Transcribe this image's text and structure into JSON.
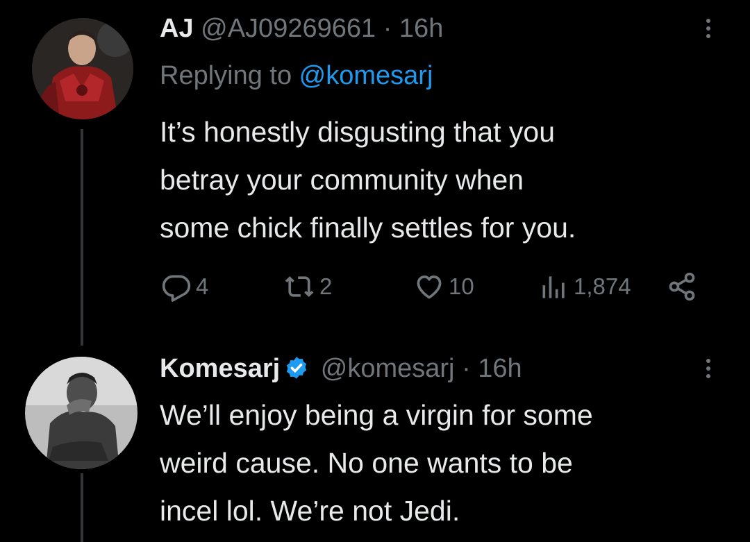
{
  "tweets": [
    {
      "name": "AJ",
      "handle": "@AJ09269661",
      "separator": "·",
      "time": "16h",
      "replying_prefix": "Replying to ",
      "replying_to": "@komesarj",
      "text": "It’s honestly disgusting that you\nbetray your community when\nsome chick finally settles for you.",
      "actions": {
        "replies": "4",
        "retweets": "2",
        "likes": "10",
        "views": "1,874"
      }
    },
    {
      "name": "Komesarj",
      "verified": true,
      "handle": "@komesarj",
      "separator": "·",
      "time": "16h",
      "text": "We’ll enjoy being a virgin for some\nweird cause. No one wants to be\nincel lol. We’re not Jedi."
    }
  ],
  "icons": {
    "reply": "reply-icon",
    "retweet": "retweet-icon",
    "like": "heart-icon",
    "views": "views-icon",
    "share": "share-icon",
    "more": "more-icon",
    "verified": "verified-badge-icon"
  },
  "colors": {
    "background": "#000000",
    "primary_text": "#e7e9ea",
    "secondary_text": "#71767b",
    "accent": "#1d9bf0"
  }
}
